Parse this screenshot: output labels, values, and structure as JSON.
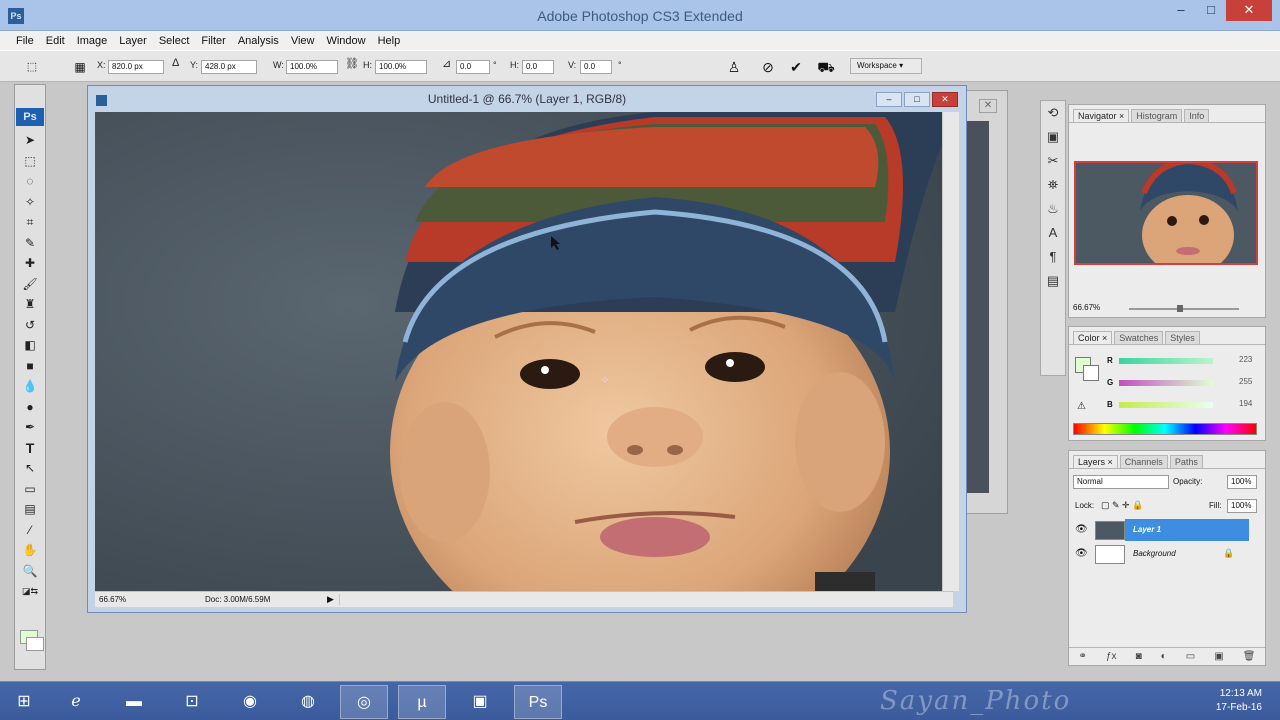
{
  "app": {
    "title": "Adobe Photoshop CS3 Extended",
    "icon_label": "Ps"
  },
  "window_controls": [
    "–",
    "□",
    "✕"
  ],
  "menu": [
    "File",
    "Edit",
    "Image",
    "Layer",
    "Select",
    "Filter",
    "Analysis",
    "View",
    "Window",
    "Help"
  ],
  "options_bar": {
    "x_label": "X:",
    "x_value": "820.0 px",
    "y_label": "Y:",
    "y_value": "428.0 px",
    "w_label": "W:",
    "w_value": "100.0%",
    "h_label": "H:",
    "h_value": "100.0%",
    "angle_value": "0.0",
    "deg1": "°",
    "hskew_label": "H:",
    "hskew_value": "0.0",
    "vskew_label": "V:",
    "vskew_value": "0.0",
    "deg2": "°",
    "workspace_label": "Workspace ▾"
  },
  "toolbox": {
    "logo": "Ps"
  },
  "document": {
    "title": "Untitled-1 @ 66.7% (Layer 1, RGB/8)",
    "zoom": "66.67%",
    "doc_info": "Doc: 3.00M/6.59M"
  },
  "navigator": {
    "tabs": [
      "Navigator ×",
      "Histogram",
      "Info"
    ],
    "zoom": "66.67%"
  },
  "color": {
    "tabs": [
      "Color ×",
      "Swatches",
      "Styles"
    ],
    "channels": [
      {
        "name": "R",
        "value": "223",
        "gradient": "#39d4a0"
      },
      {
        "name": "G",
        "value": "255",
        "gradient": "#c050c0"
      },
      {
        "name": "B",
        "value": "194",
        "gradient": "#c8e850"
      }
    ],
    "fg_color": "#dfffd0"
  },
  "layers": {
    "tabs": [
      "Layers ×",
      "Channels",
      "Paths"
    ],
    "blend_mode": "Normal",
    "opacity_label": "Opacity:",
    "opacity_value": "100%",
    "lock_label": "Lock:",
    "fill_label": "Fill:",
    "fill_value": "100%",
    "items": [
      {
        "name": "Layer 1",
        "selected": true
      },
      {
        "name": "Background",
        "selected": false
      }
    ]
  },
  "taskbar": {
    "watermark": "Sayan_Photo",
    "time": "12:13 AM",
    "date": "17-Feb-16"
  }
}
